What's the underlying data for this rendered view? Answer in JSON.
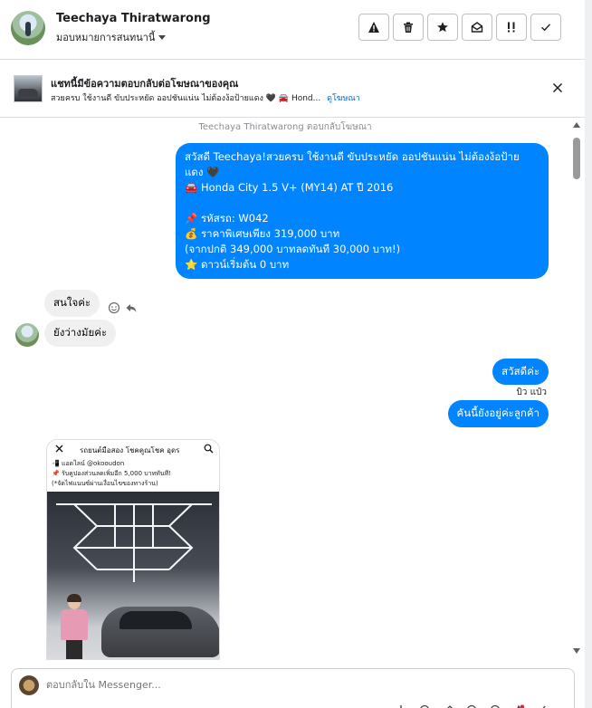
{
  "header": {
    "contact_name": "Teechaya Thiratwarong",
    "assign_label": "มอบหมายการสนทนานี้"
  },
  "actions": [
    {
      "icon": "warning-icon"
    },
    {
      "icon": "trash-icon"
    },
    {
      "icon": "star-icon"
    },
    {
      "icon": "mark-unread-icon"
    },
    {
      "icon": "priority-icon"
    },
    {
      "icon": "check-icon"
    }
  ],
  "ad_banner": {
    "title": "แชทนี้มีข้อความตอบกลับต่อโฆษณาของคุณ",
    "subtitle": "สวยครบ ใช้งานดี ขับประหยัด ออปชันแน่น ไม่ต้องง้อป้ายแดง 🖤 🚘 Hond...",
    "link": "ดูโฆษณา"
  },
  "chat": {
    "system_line": "Teechaya Thiratwarong ตอบกลับโฆษณา",
    "ad_message_lines": [
      "สวัสดี Teechaya!สวยครบ ใช้งานดี ขับประหยัด ออปชันแน่น ไม่ต้องง้อป้าย",
      "แดง 🖤",
      "🚘 Honda City 1.5 V+ (MY14) AT ปี 2016",
      "",
      "📌 รหัสรถ: W042",
      "💰 ราคาพิเศษเพียง 319,000 บาท",
      "(จากปกติ 349,000 บาทลดทันที 30,000 บาท!)",
      "⭐ ดาวน์เริ่มต้น 0 บาท"
    ],
    "incoming_1": "สนใจค่ะ",
    "incoming_2": "ยังว่างมัยค่ะ",
    "outgoing_1": "สวัสดีค่ะ",
    "sender_name": "บิว แป๋ว",
    "outgoing_2": "คันนี้ยังอยู่ค่ะลูกค้า",
    "shared_image": {
      "title": "รถยนต์มือสอง โชคคูณโชค อุดร",
      "line_1": "📲 แอดไลน์ @okooudon",
      "line_2": "📌 รับคูปองส่วนลดเพิ่มอีก 5,000 บาททันที!",
      "line_3": "(*จัดไฟแนนซ์ผ่านเงื่อนไขของทางร้าน)"
    }
  },
  "composer": {
    "placeholder": "ตอบกลับใน Messenger..."
  },
  "colors": {
    "outgoing_bubble": "#0084ff",
    "incoming_bubble": "#f0f0f0",
    "link": "#0064d1"
  }
}
